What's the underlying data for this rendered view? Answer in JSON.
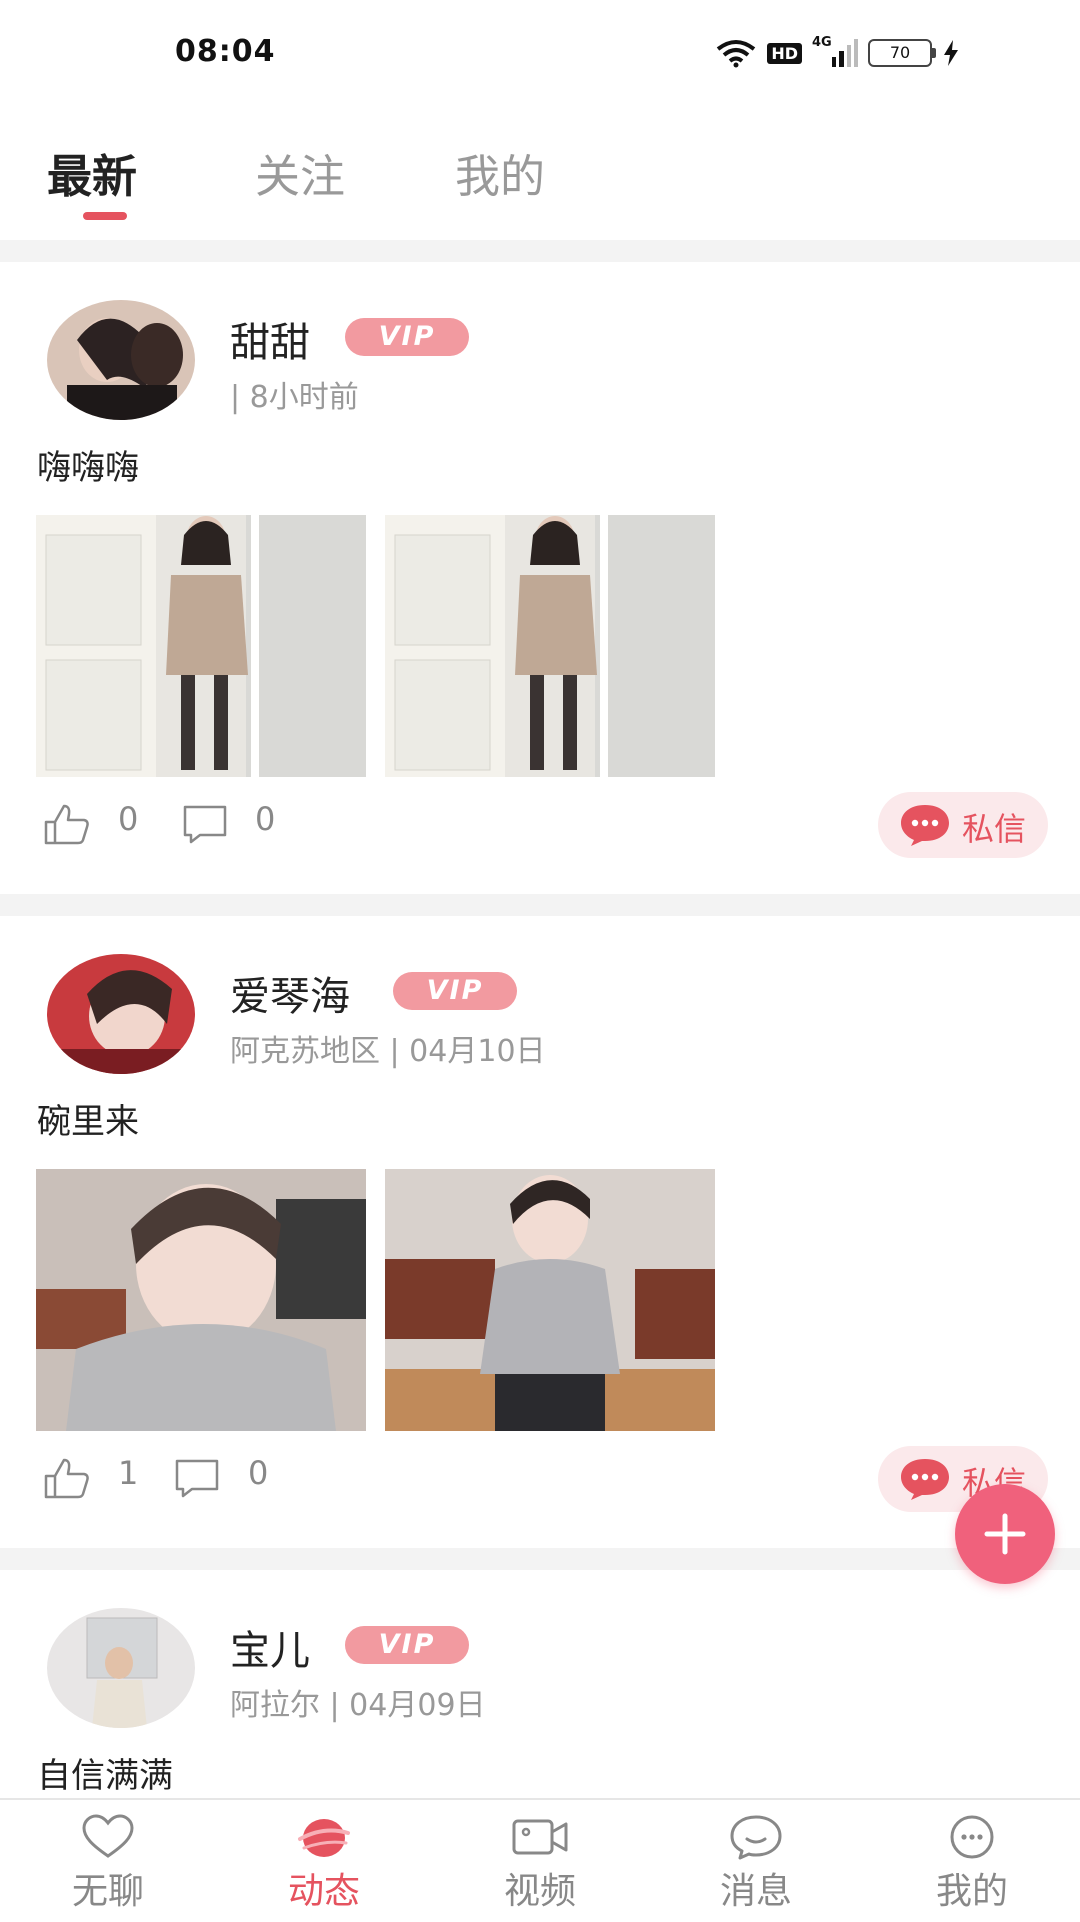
{
  "status_bar": {
    "time": "08:04",
    "hd": "HD",
    "network": "4G",
    "battery": "70"
  },
  "tabs": [
    {
      "label": "最新",
      "active": true
    },
    {
      "label": "关注",
      "active": false
    },
    {
      "label": "我的",
      "active": false
    }
  ],
  "posts": [
    {
      "username": "甜甜",
      "badge": "VIP",
      "meta": "| 8小时前",
      "text": "嗨嗨嗨",
      "likes": "0",
      "comments": "0",
      "dm_label": "私信"
    },
    {
      "username": "爱琴海",
      "badge": "VIP",
      "meta": "阿克苏地区 | 04月10日",
      "text": "碗里来",
      "likes": "1",
      "comments": "0",
      "dm_label": "私信"
    },
    {
      "username": "宝儿",
      "badge": "VIP",
      "meta": "阿拉尔 | 04月09日",
      "text": "自信满满"
    }
  ],
  "bottom_nav": [
    {
      "label": "无聊",
      "icon": "heart-icon",
      "active": false
    },
    {
      "label": "动态",
      "icon": "planet-icon",
      "active": true
    },
    {
      "label": "视频",
      "icon": "video-camera-icon",
      "active": false
    },
    {
      "label": "消息",
      "icon": "chat-bubble-icon",
      "active": false
    },
    {
      "label": "我的",
      "icon": "smiley-icon",
      "active": false
    }
  ],
  "colors": {
    "accent": "#e5535f",
    "vip": "#f29aa0",
    "fab": "#f0617c",
    "divider": "#f3f3f3",
    "muted": "#999999"
  }
}
